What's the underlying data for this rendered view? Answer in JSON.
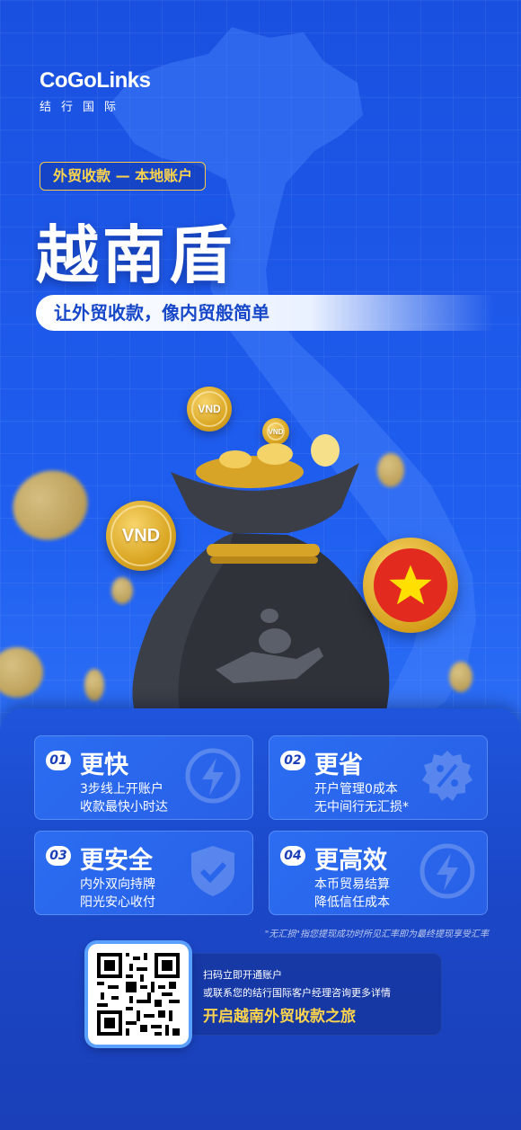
{
  "brand": {
    "name": "CoGoLinks",
    "name_cn": "结行国际"
  },
  "tag": "外贸收款 — 本地账户",
  "headline": "越南盾",
  "slogan": "让外贸收款，像内贸般简单",
  "coin_label": "VND",
  "features": [
    {
      "num": "01",
      "title": "更快",
      "lines": [
        "3步线上开账户",
        "收款最快小时达"
      ],
      "icon": "lightning-icon"
    },
    {
      "num": "02",
      "title": "更省",
      "lines": [
        "开户管理0成本",
        "无中间行无汇损*"
      ],
      "icon": "percent-badge-icon"
    },
    {
      "num": "03",
      "title": "更安全",
      "lines": [
        "内外双向持牌",
        "阳光安心收付"
      ],
      "icon": "shield-check-icon"
    },
    {
      "num": "04",
      "title": "更高效",
      "lines": [
        "本币贸易结算",
        "降低信任成本"
      ],
      "icon": "lightning-icon"
    }
  ],
  "footnote": "\"无汇损\"指您提现成功时所见汇率即为最终提现享受汇率",
  "cta": {
    "line1": "扫码立即开通账户",
    "line2": "或联系您的结行国际客户经理咨询更多详情",
    "headline": "开启越南外贸收款之旅"
  },
  "colors": {
    "primary": "#1d5be8",
    "gold": "#fbd34d",
    "flag_red": "#e22a1e"
  }
}
